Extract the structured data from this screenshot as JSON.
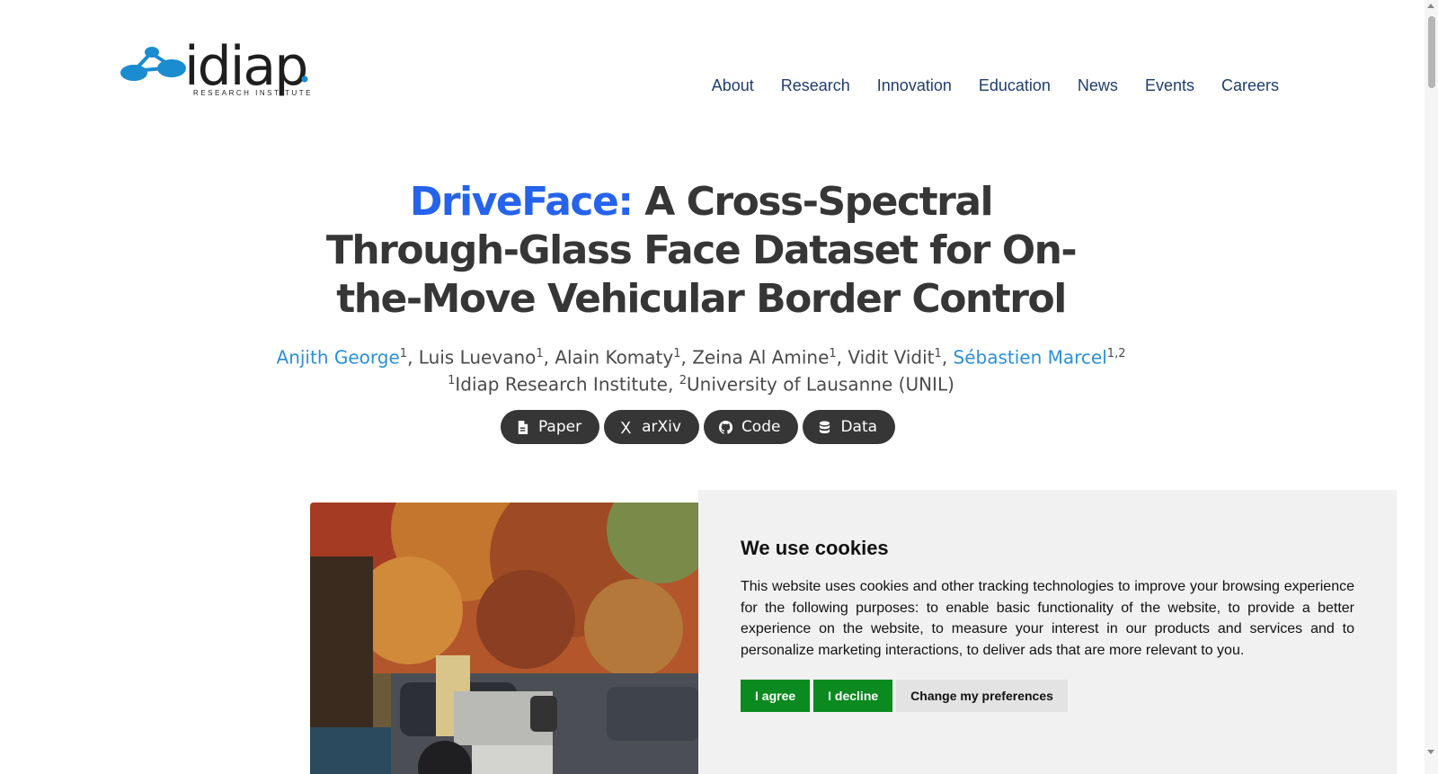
{
  "header": {
    "logo_text": "idiap",
    "logo_subtitle": "RESEARCH INSTITUTE",
    "nav": [
      "About",
      "Research",
      "Innovation",
      "Education",
      "News",
      "Events",
      "Careers"
    ]
  },
  "hero": {
    "title_highlight": "DriveFace:",
    "title_rest": " A Cross-Spectral Through-Glass Face Dataset for On-the-Move Vehicular Border Control",
    "authors": [
      {
        "name": "Anjith George",
        "sup": "1",
        "linked": true
      },
      {
        "name": "Luis Luevano",
        "sup": "1",
        "linked": false
      },
      {
        "name": "Alain Komaty",
        "sup": "1",
        "linked": false
      },
      {
        "name": "Zeina Al Amine",
        "sup": "1",
        "linked": false
      },
      {
        "name": "Vidit Vidit",
        "sup": "1",
        "linked": false
      },
      {
        "name": "Sébastien Marcel",
        "sup": "1,2",
        "linked": true
      }
    ],
    "affiliations": [
      {
        "sup": "1",
        "name": "Idiap Research Institute"
      },
      {
        "sup": "2",
        "name": "University of Lausanne (UNIL)"
      }
    ],
    "buttons": [
      {
        "label": "Paper",
        "icon": "file-pdf-icon"
      },
      {
        "label": "arXiv",
        "icon": "arxiv-icon"
      },
      {
        "label": "Code",
        "icon": "github-icon"
      },
      {
        "label": "Data",
        "icon": "database-icon"
      }
    ]
  },
  "cookie": {
    "title": "We use cookies",
    "body": "This website uses cookies and other tracking technologies to improve your browsing experience for the following purposes: to enable basic functionality of the website, to provide a better experience on the website, to measure your interest in our products and services and to personalize marketing interactions, to deliver ads that are more relevant to you.",
    "agree": "I agree",
    "decline": "I decline",
    "preferences": "Change my preferences"
  },
  "colors": {
    "accent": "#2563eb",
    "author_link": "#2b8fd8",
    "nav_link": "#1f3d6e",
    "button_dark": "#363636",
    "cookie_green": "#0b8a1f",
    "logo_blue": "#1a8ccf"
  }
}
